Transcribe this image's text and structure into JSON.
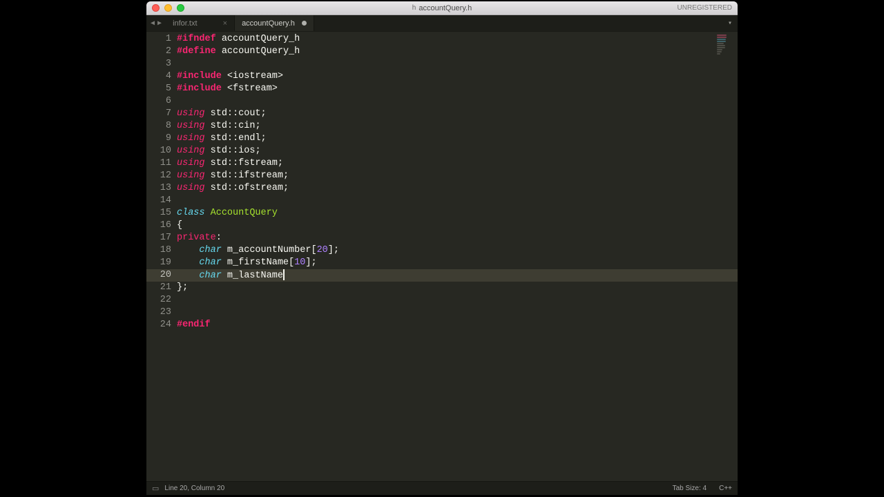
{
  "window": {
    "title": "accountQuery.h",
    "registration": "UNREGISTERED"
  },
  "tabs": [
    {
      "label": "infor.txt",
      "active": false,
      "modified": false
    },
    {
      "label": "accountQuery.h",
      "active": true,
      "modified": true
    }
  ],
  "status": {
    "position": "Line 20, Column 20",
    "tab_size": "Tab Size: 4",
    "syntax": "C++"
  },
  "code": {
    "line_count": 24,
    "current_line": 20,
    "lines": [
      {
        "n": 1,
        "tokens": [
          [
            "pre",
            "#ifndef"
          ],
          [
            "sp",
            " "
          ],
          [
            "macro",
            "accountQuery_h"
          ]
        ]
      },
      {
        "n": 2,
        "tokens": [
          [
            "pre",
            "#define"
          ],
          [
            "sp",
            " "
          ],
          [
            "macro",
            "accountQuery_h"
          ]
        ]
      },
      {
        "n": 3,
        "tokens": []
      },
      {
        "n": 4,
        "tokens": [
          [
            "pre",
            "#include"
          ],
          [
            "sp",
            " "
          ],
          [
            "punc",
            "<iostream>"
          ]
        ]
      },
      {
        "n": 5,
        "tokens": [
          [
            "pre",
            "#include"
          ],
          [
            "sp",
            " "
          ],
          [
            "punc",
            "<fstream>"
          ]
        ]
      },
      {
        "n": 6,
        "tokens": []
      },
      {
        "n": 7,
        "tokens": [
          [
            "kw",
            "using"
          ],
          [
            "sp",
            " "
          ],
          [
            "ident",
            "std::cout"
          ],
          [
            "punc",
            ";"
          ]
        ]
      },
      {
        "n": 8,
        "tokens": [
          [
            "kw",
            "using"
          ],
          [
            "sp",
            " "
          ],
          [
            "ident",
            "std::cin"
          ],
          [
            "punc",
            ";"
          ]
        ]
      },
      {
        "n": 9,
        "tokens": [
          [
            "kw",
            "using"
          ],
          [
            "sp",
            " "
          ],
          [
            "ident",
            "std::endl"
          ],
          [
            "punc",
            ";"
          ]
        ]
      },
      {
        "n": 10,
        "tokens": [
          [
            "kw",
            "using"
          ],
          [
            "sp",
            " "
          ],
          [
            "ident",
            "std::ios"
          ],
          [
            "punc",
            ";"
          ]
        ]
      },
      {
        "n": 11,
        "tokens": [
          [
            "kw",
            "using"
          ],
          [
            "sp",
            " "
          ],
          [
            "ident",
            "std::fstream"
          ],
          [
            "punc",
            ";"
          ]
        ]
      },
      {
        "n": 12,
        "tokens": [
          [
            "kw",
            "using"
          ],
          [
            "sp",
            " "
          ],
          [
            "ident",
            "std::ifstream"
          ],
          [
            "punc",
            ";"
          ]
        ]
      },
      {
        "n": 13,
        "tokens": [
          [
            "kw",
            "using"
          ],
          [
            "sp",
            " "
          ],
          [
            "ident",
            "std::ofstream"
          ],
          [
            "punc",
            ";"
          ]
        ]
      },
      {
        "n": 14,
        "tokens": []
      },
      {
        "n": 15,
        "tokens": [
          [
            "kw2",
            "class"
          ],
          [
            "sp",
            " "
          ],
          [
            "classname",
            "AccountQuery"
          ]
        ]
      },
      {
        "n": 16,
        "tokens": [
          [
            "punc",
            "{"
          ]
        ]
      },
      {
        "n": 17,
        "tokens": [
          [
            "priv",
            "private"
          ],
          [
            "punc",
            ":"
          ]
        ]
      },
      {
        "n": 18,
        "tokens": [
          [
            "sp",
            "    "
          ],
          [
            "type",
            "char"
          ],
          [
            "sp",
            " "
          ],
          [
            "ident",
            "m_accountNumber"
          ],
          [
            "punc",
            "["
          ],
          [
            "num",
            "20"
          ],
          [
            "punc",
            "];"
          ]
        ]
      },
      {
        "n": 19,
        "tokens": [
          [
            "sp",
            "    "
          ],
          [
            "type",
            "char"
          ],
          [
            "sp",
            " "
          ],
          [
            "ident",
            "m_firstName"
          ],
          [
            "punc",
            "["
          ],
          [
            "num",
            "10"
          ],
          [
            "punc",
            "];"
          ]
        ]
      },
      {
        "n": 20,
        "tokens": [
          [
            "sp",
            "    "
          ],
          [
            "type",
            "char"
          ],
          [
            "sp",
            " "
          ],
          [
            "ident",
            "m_lastName"
          ],
          [
            "cursor",
            ""
          ]
        ]
      },
      {
        "n": 21,
        "tokens": [
          [
            "punc",
            "};"
          ]
        ]
      },
      {
        "n": 22,
        "tokens": []
      },
      {
        "n": 23,
        "tokens": []
      },
      {
        "n": 24,
        "tokens": [
          [
            "pre",
            "#endif"
          ]
        ]
      }
    ]
  }
}
